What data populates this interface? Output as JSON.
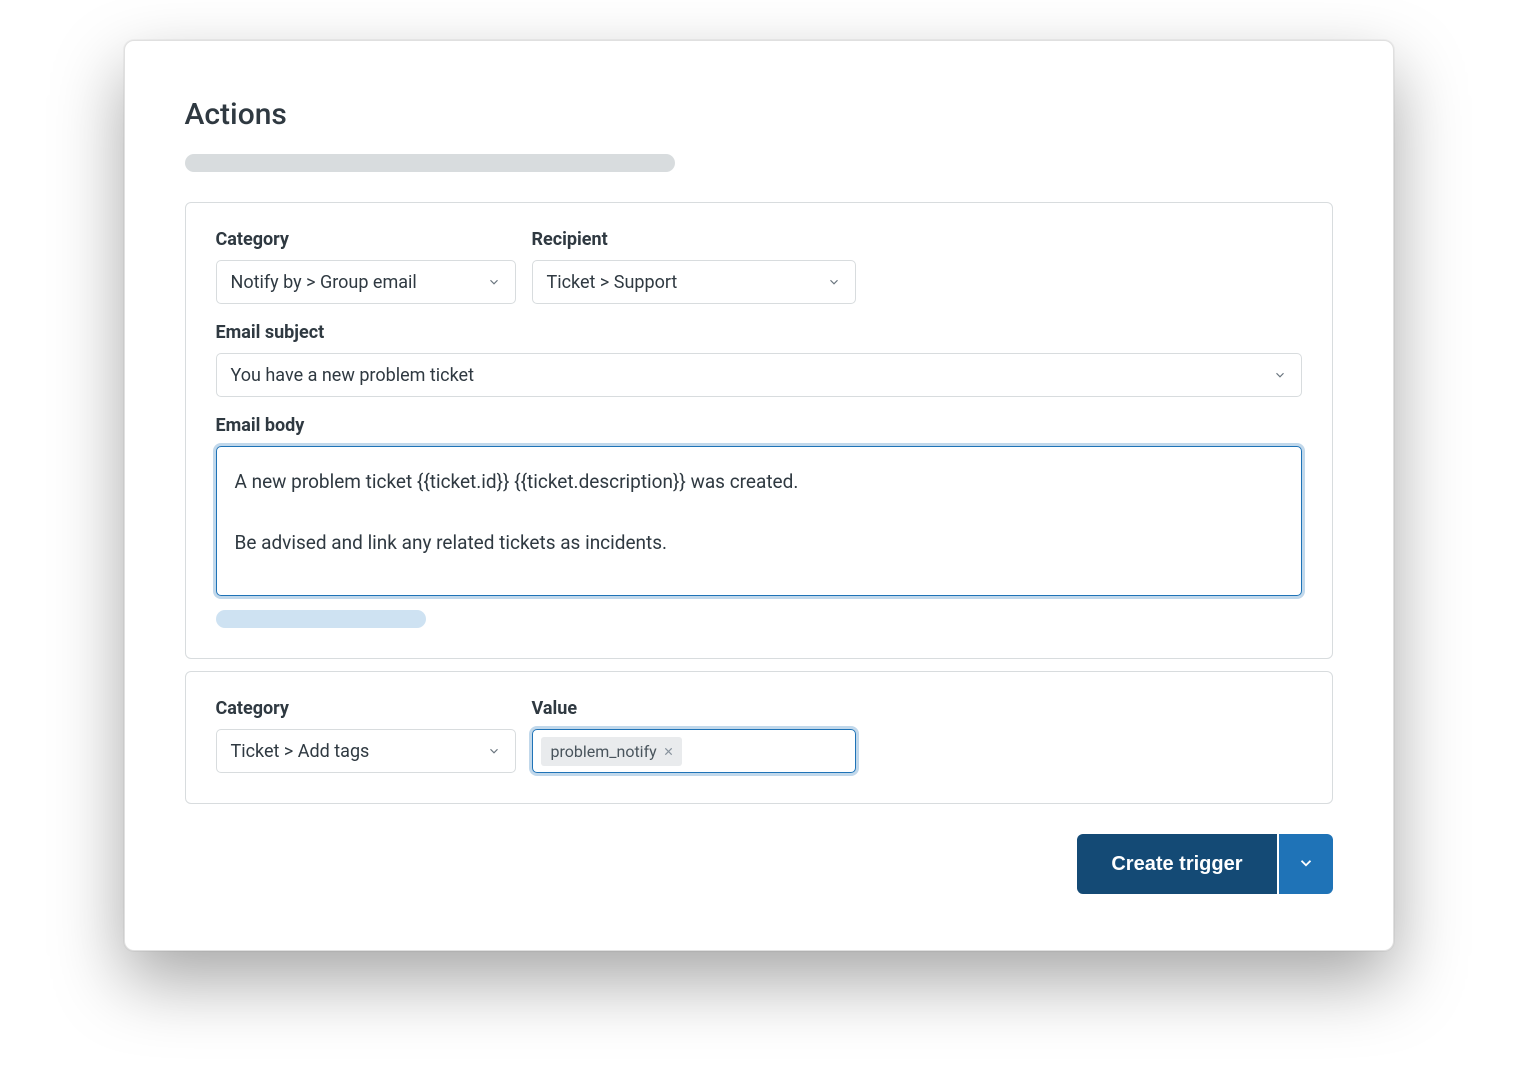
{
  "title": "Actions",
  "action1": {
    "category_label": "Category",
    "category_value": "Notify by > Group email",
    "recipient_label": "Recipient",
    "recipient_value": "Ticket > Support",
    "subject_label": "Email subject",
    "subject_value": "You have a new problem ticket",
    "body_label": "Email body",
    "body_value": "A new problem ticket {{ticket.id}} {{ticket.description}} was created.\n\nBe advised and link any related tickets as incidents."
  },
  "action2": {
    "category_label": "Category",
    "category_value": "Ticket > Add tags",
    "value_label": "Value",
    "tags": [
      "problem_notify"
    ]
  },
  "submit_label": "Create trigger",
  "colors": {
    "primary_dark": "#144a75",
    "primary": "#1f73b7",
    "border": "#d8dcde"
  }
}
